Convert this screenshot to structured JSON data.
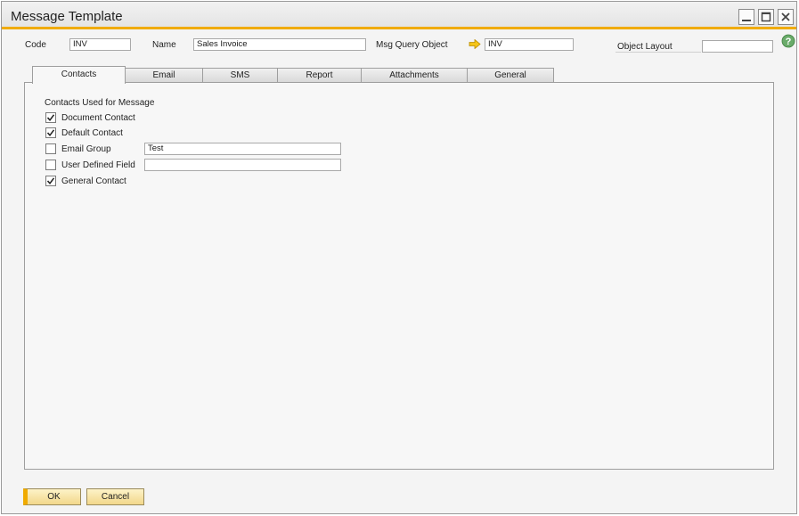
{
  "window": {
    "title": "Message Template",
    "controls": [
      "minimize-icon",
      "maximize-icon",
      "close-icon"
    ]
  },
  "header": {
    "code_label": "Code",
    "code_value": "INV",
    "name_label": "Name",
    "name_value": "Sales Invoice",
    "msg_query_label": "Msg Query Object",
    "msg_query_value": "INV",
    "object_layout_label": "Object Layout",
    "object_layout_value": ""
  },
  "tabs": [
    {
      "label": "Contacts",
      "active": true
    },
    {
      "label": "Email",
      "active": false
    },
    {
      "label": "SMS",
      "active": false
    },
    {
      "label": "Report",
      "active": false
    },
    {
      "label": "Attachments",
      "active": false
    },
    {
      "label": "General",
      "active": false
    }
  ],
  "contacts": {
    "section_title": "Contacts Used for Message",
    "items": [
      {
        "label": "Document Contact",
        "checked": true
      },
      {
        "label": "Default Contact",
        "checked": true
      },
      {
        "label": "Email Group",
        "checked": false,
        "value": "Test"
      },
      {
        "label": "User Defined Field",
        "checked": false,
        "value": ""
      },
      {
        "label": "General Contact",
        "checked": true
      }
    ]
  },
  "buttons": {
    "ok": "OK",
    "cancel": "Cancel"
  },
  "colors": {
    "accent": "#f0ab00",
    "link_arrow": "#f0c000",
    "help": "#5fa85f"
  }
}
